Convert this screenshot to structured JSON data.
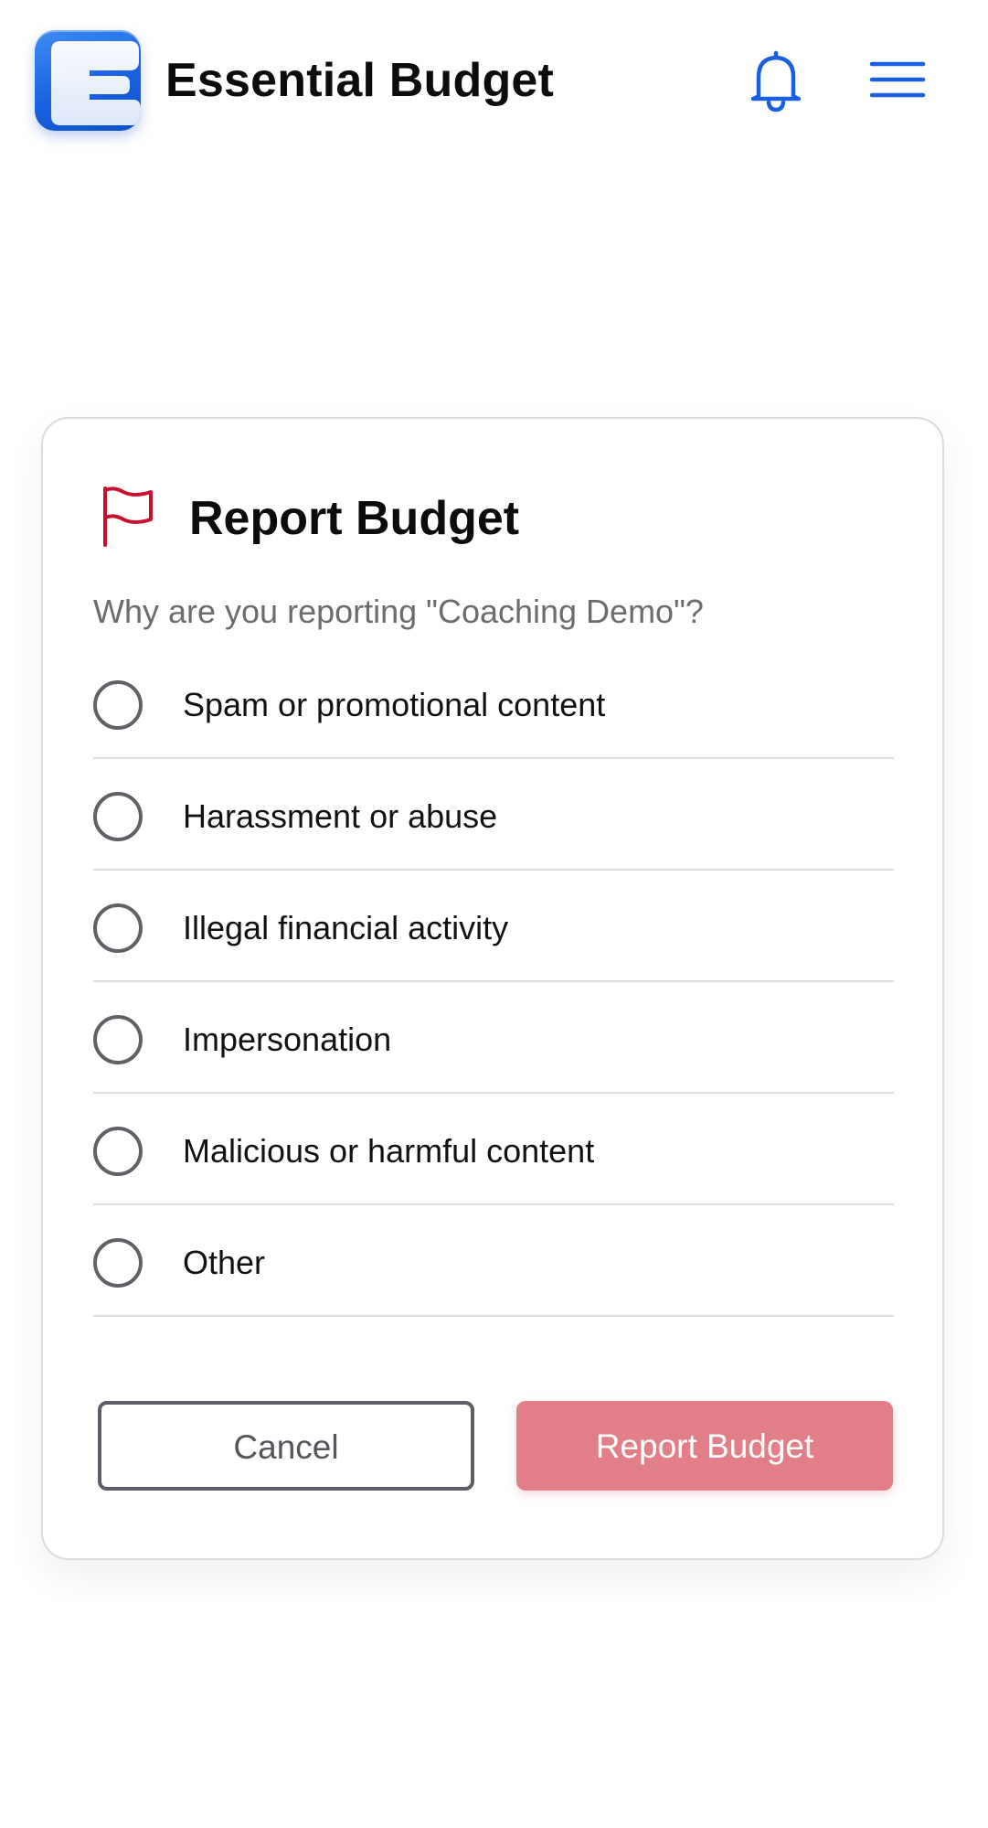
{
  "header": {
    "app_title": "Essential Budget",
    "logo_letter": "E",
    "logo_icon": "app-logo",
    "notifications_icon": "bell-icon",
    "menu_icon": "hamburger-menu-icon",
    "accent_color": "#1a62e0"
  },
  "report_dialog": {
    "flag_icon": "flag-icon",
    "flag_color": "#c8102e",
    "title": "Report Budget",
    "question": "Why are you reporting \"Coaching Demo\"?",
    "options": [
      {
        "label": "Spam or promotional content",
        "selected": false
      },
      {
        "label": "Harassment or abuse",
        "selected": false
      },
      {
        "label": "Illegal financial activity",
        "selected": false
      },
      {
        "label": "Impersonation",
        "selected": false
      },
      {
        "label": "Malicious or harmful content",
        "selected": false
      },
      {
        "label": "Other",
        "selected": false
      }
    ],
    "cancel_label": "Cancel",
    "submit_label": "Report Budget",
    "submit_color": "#e27e87",
    "submit_disabled": true
  }
}
